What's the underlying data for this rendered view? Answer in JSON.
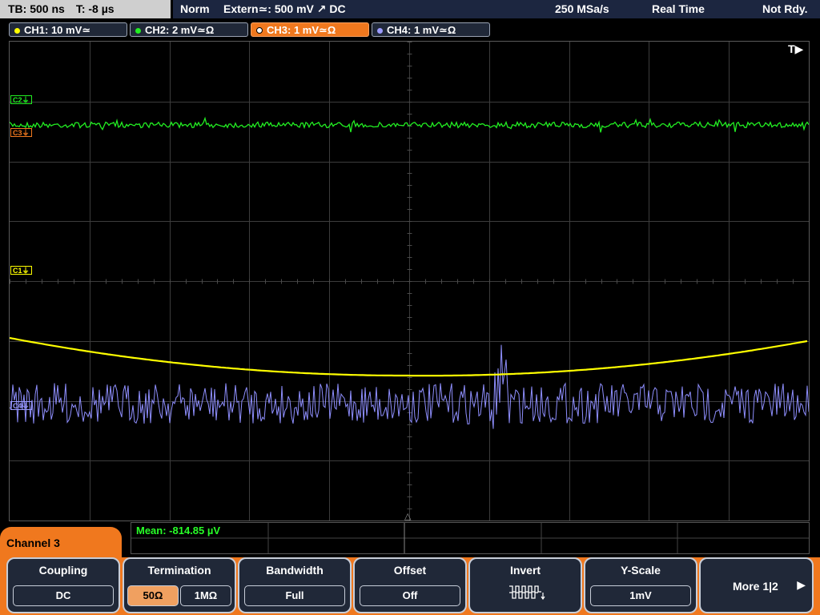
{
  "top_bar": {
    "timebase": "TB: 500 ns",
    "trigger_time": "T: -8 µs",
    "mode": "Norm",
    "trigger_source": "Extern≃: 500 mV ↗ DC",
    "sample_rate": "250 MSa/s",
    "acq_mode": "Real Time",
    "trigger_status": "Not Rdy."
  },
  "channels": [
    {
      "label": "CH1: 10 mV≃",
      "color": "#ffff00"
    },
    {
      "label": "CH2: 2 mV≃Ω",
      "color": "#22ee22"
    },
    {
      "label": "CH3: 1 mV≃Ω",
      "color": "#f0781e"
    },
    {
      "label": "CH4: 1 mV≃Ω",
      "color": "#9b9bff"
    }
  ],
  "trace_markers": {
    "c2": "C2⏚",
    "c3": "C3⏚",
    "c1": "C1⏚",
    "c4": "C4⏚",
    "trigger": "T▶"
  },
  "measurement": {
    "text": "Mean: -814.85 µV"
  },
  "menu": {
    "title": "Channel 3",
    "softkeys": {
      "coupling": {
        "label": "Coupling",
        "value": "DC"
      },
      "termination": {
        "label": "Termination",
        "option_50": "50Ω",
        "option_1m": "1MΩ"
      },
      "bandwidth": {
        "label": "Bandwidth",
        "value": "Full"
      },
      "offset": {
        "label": "Offset",
        "value": "Off"
      },
      "invert": {
        "label": "Invert",
        "icon": "inverted-pulse-icon"
      },
      "yscale": {
        "label": "Y-Scale",
        "value": "1mV"
      },
      "more": {
        "label": "More 1|2",
        "icon": "right-arrow-icon"
      }
    }
  },
  "trace_colors": {
    "ch1": "#ffff00",
    "ch2": "#22ee22",
    "ch4": "#8f8fff",
    "grid": "#3c3c3c"
  }
}
